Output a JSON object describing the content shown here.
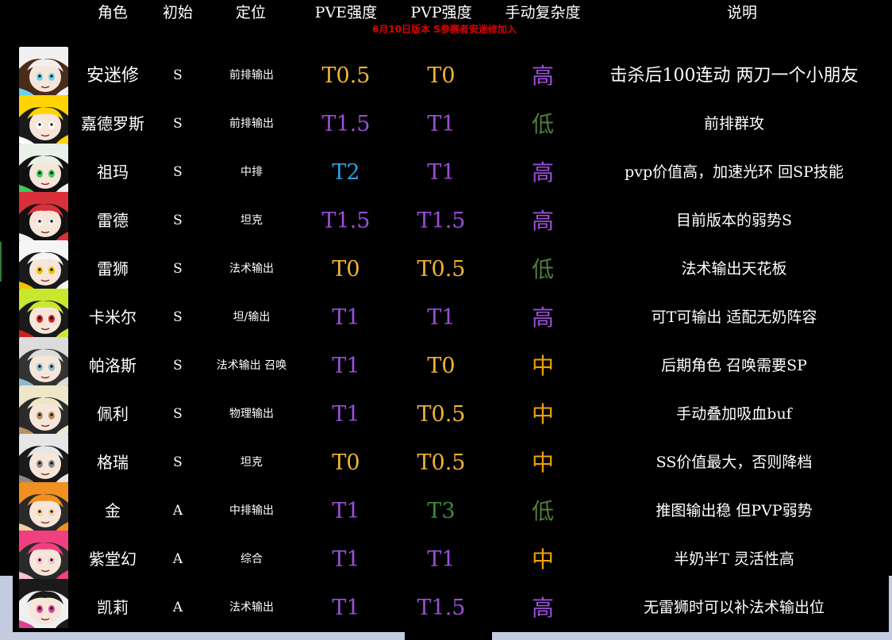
{
  "headers": {
    "character": "角色",
    "initial": "初始",
    "position": "定位",
    "pve": "PVE强度",
    "pvp": "PVP强度",
    "complexity": "手动复杂度",
    "description": "说明"
  },
  "note": "6月10日版本 S参赛者安迷修加入",
  "colors": {
    "T0": "#f2b52e",
    "T0.5": "#f2b52e",
    "T1": "#9b4fd8",
    "T1.5": "#9b4fd8",
    "T2": "#2fa0e0",
    "T3": "#3c8a3c",
    "高": "#9b4fd8",
    "中": "#f2a100",
    "低": "#4f7d3d"
  },
  "rows": [
    {
      "name": "安迷修",
      "initial": "S",
      "role": "前排输出",
      "pve": "T0.5",
      "pvp": "T0",
      "complexity": "高",
      "desc": "击杀后100连动 两刀一个小朋友",
      "avatar_icon": "brown-hair-portrait",
      "avatar_colors": [
        "#f0f0f0",
        "#4a2b1a",
        "#6ad0f0"
      ]
    },
    {
      "name": "嘉德罗斯",
      "initial": "S",
      "role": "前排输出",
      "pve": "T1.5",
      "pvp": "T1",
      "complexity": "低",
      "desc": "前排群攻",
      "avatar_icon": "yellow-hair-portrait",
      "avatar_colors": [
        "#ffd400",
        "#1a1a1a",
        "#ffffff"
      ]
    },
    {
      "name": "祖玛",
      "initial": "S",
      "role": "中排",
      "pve": "T2",
      "pvp": "T1",
      "complexity": "高",
      "desc": "pvp价值高，加速光环 回SP技能",
      "avatar_icon": "green-mask-portrait",
      "avatar_colors": [
        "#e8f0e8",
        "#111111",
        "#3cc85a"
      ]
    },
    {
      "name": "雷德",
      "initial": "S",
      "role": "坦克",
      "pve": "T1.5",
      "pvp": "T1.5",
      "complexity": "高",
      "desc": "目前版本的弱势S",
      "avatar_icon": "red-hair-portrait",
      "avatar_colors": [
        "#d8303a",
        "#111111",
        "#f0f0f0"
      ]
    },
    {
      "name": "雷狮",
      "initial": "S",
      "role": "法术输出",
      "pve": "T0",
      "pvp": "T0.5",
      "complexity": "低",
      "desc": "法术输出天花板",
      "avatar_icon": "star-hat-portrait",
      "avatar_colors": [
        "#f5f5f5",
        "#1a1a1a",
        "#f2c200"
      ]
    },
    {
      "name": "卡米尔",
      "initial": "S",
      "role": "坦/输出",
      "pve": "T1",
      "pvp": "T1",
      "complexity": "高",
      "desc": "可T可输出 适配无奶阵容",
      "avatar_icon": "masked-portrait",
      "avatar_colors": [
        "#c8e830",
        "#1a1a1a",
        "#d02020"
      ]
    },
    {
      "name": "帕洛斯",
      "initial": "S",
      "role": "法术输出 召唤",
      "pve": "T1",
      "pvp": "T0",
      "complexity": "中",
      "desc": "后期角色 召唤需要SP",
      "avatar_icon": "white-hair-portrait",
      "avatar_colors": [
        "#dcdcdc",
        "#333333",
        "#8bbbd0"
      ]
    },
    {
      "name": "佩利",
      "initial": "S",
      "role": "物理输出",
      "pve": "T1",
      "pvp": "T0.5",
      "complexity": "中",
      "desc": "手动叠加吸血buf",
      "avatar_icon": "blonde-portrait",
      "avatar_colors": [
        "#efe6c8",
        "#2a2a2a",
        "#b89060"
      ]
    },
    {
      "name": "格瑞",
      "initial": "S",
      "role": "坦克",
      "pve": "T0",
      "pvp": "T0.5",
      "complexity": "中",
      "desc": "SS价值最大，否则降档",
      "avatar_icon": "silver-hair-portrait",
      "avatar_colors": [
        "#e6e6e6",
        "#1a1a1a",
        "#8a8a8a"
      ]
    },
    {
      "name": "金",
      "initial": "A",
      "role": "中排输出",
      "pve": "T1",
      "pvp": "T3",
      "complexity": "低",
      "desc": "推图输出稳 但PVP弱势",
      "avatar_icon": "orange-hat-portrait",
      "avatar_colors": [
        "#f09020",
        "#2a2a2a",
        "#f5d0a0"
      ]
    },
    {
      "name": "紫堂幻",
      "initial": "A",
      "role": "综合",
      "pve": "T1",
      "pvp": "T1",
      "complexity": "中",
      "desc": "半奶半T 灵活性高",
      "avatar_icon": "pink-hair-portrait",
      "avatar_colors": [
        "#f04080",
        "#2a2a2a",
        "#f8c0d0"
      ]
    },
    {
      "name": "凯莉",
      "initial": "A",
      "role": "法术输出",
      "pve": "T1",
      "pvp": "T1.5",
      "complexity": "高",
      "desc": "无雷狮时可以补法术输出位",
      "avatar_icon": "black-hair-portrait",
      "avatar_colors": [
        "#1a1a1a",
        "#f0f0f0",
        "#e04090"
      ]
    }
  ]
}
